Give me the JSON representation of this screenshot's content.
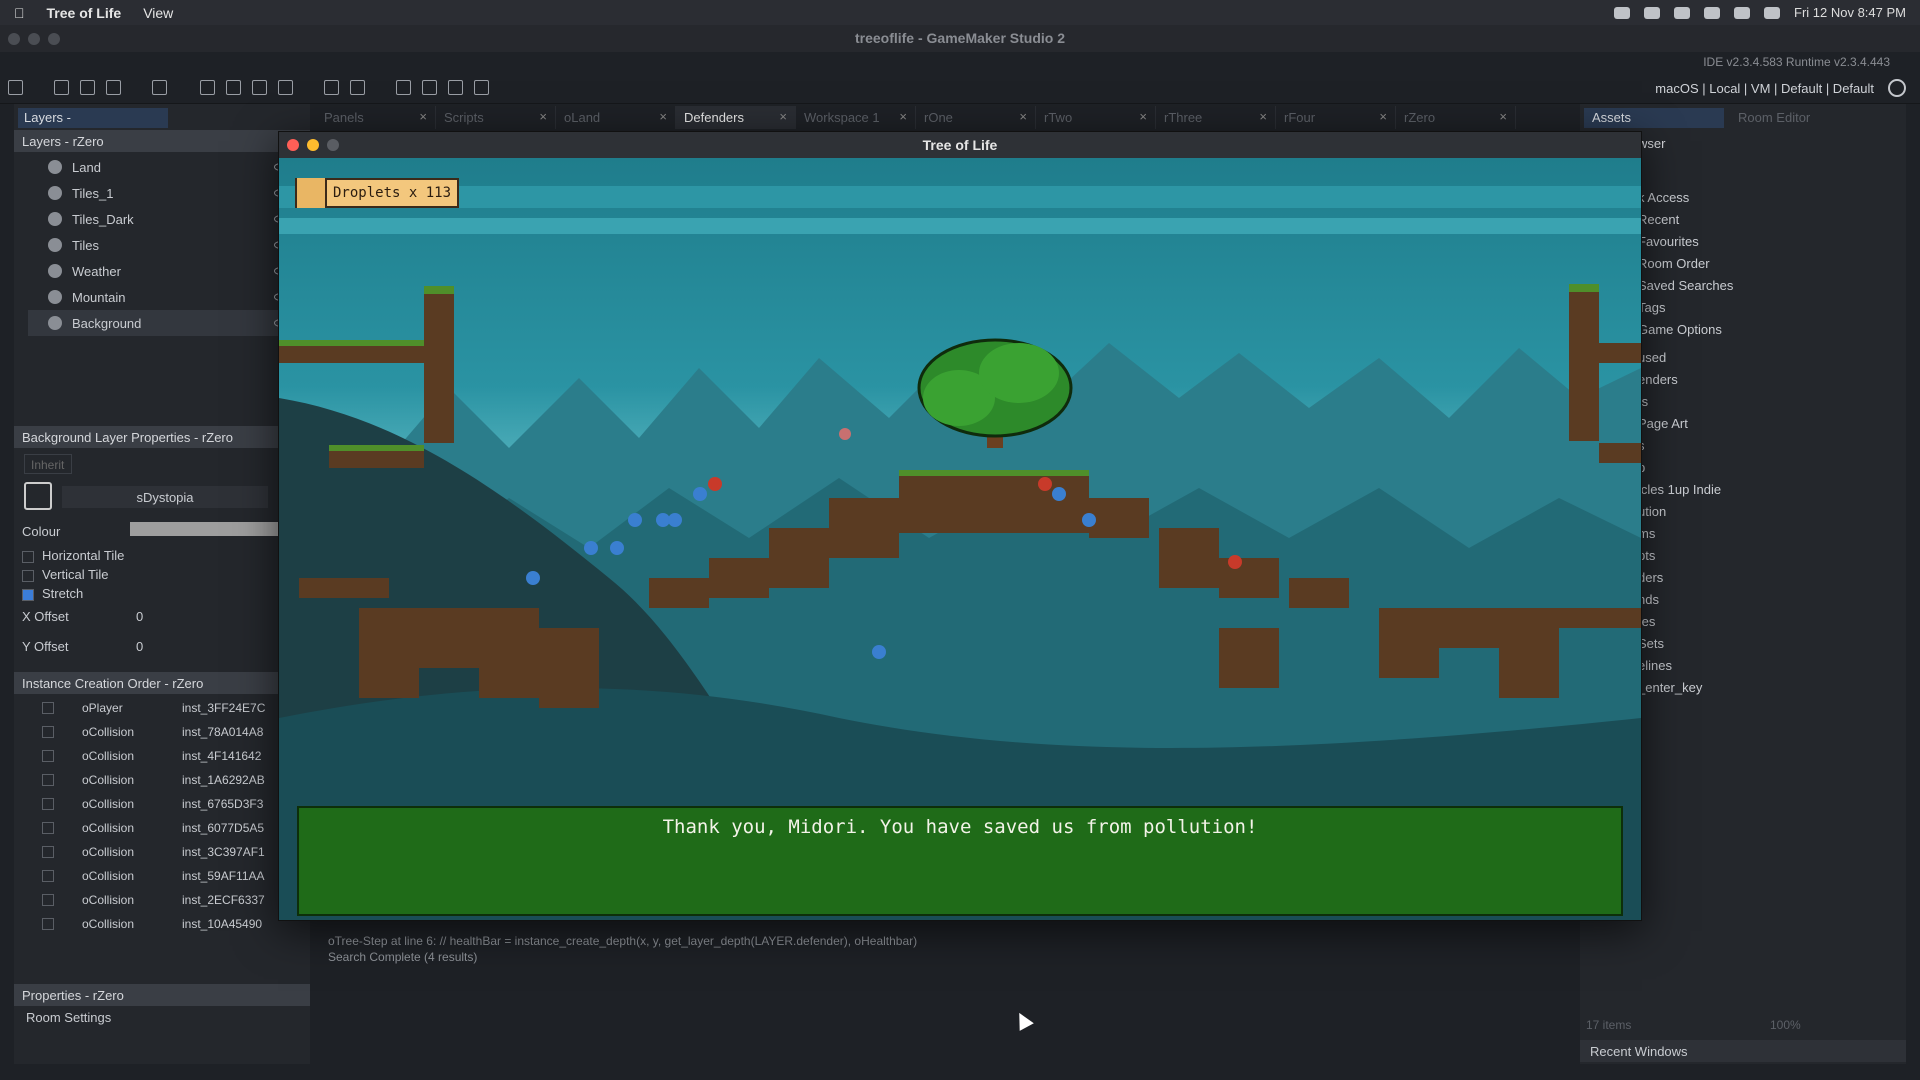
{
  "menubar": {
    "app_name": "Tree of Life",
    "view_menu": "View",
    "datetime": "Fri 12 Nov  8:47 PM"
  },
  "window": {
    "title": "treeoflife - GameMaker Studio 2",
    "ide_version": "IDE v2.3.4.583  Runtime v2.3.4.443"
  },
  "toolbar": {
    "targets": "macOS | Local | VM | Default | Default"
  },
  "tabs": [
    {
      "label": "Panels"
    },
    {
      "label": "Scripts"
    },
    {
      "label": "oLand"
    },
    {
      "label": "Defenders"
    },
    {
      "label": "Workspace 1"
    },
    {
      "label": "rOne"
    },
    {
      "label": "rTwo"
    },
    {
      "label": "rThree"
    },
    {
      "label": "rFour"
    },
    {
      "label": "rZero"
    }
  ],
  "left_panel": {
    "tab_label": "Layers -",
    "layers_title": "Layers - rZero",
    "layers": [
      {
        "label": "Land"
      },
      {
        "label": "Tiles_1"
      },
      {
        "label": "Tiles_Dark"
      },
      {
        "label": "Tiles"
      },
      {
        "label": "Weather"
      },
      {
        "label": "Mountain"
      },
      {
        "label": "Background"
      }
    ],
    "bg_props_title": "Background Layer Properties - rZero",
    "inherit": "Inherit",
    "sprite": "sDystopia",
    "colour": "Colour",
    "horizontal_tile": "Horizontal Tile",
    "vertical_tile": "Vertical Tile",
    "stretch": "Stretch",
    "x_offset_label": "X Offset",
    "x_offset": "0",
    "y_offset_label": "Y Offset",
    "y_offset": "0",
    "inst_title": "Instance Creation Order - rZero",
    "instances": [
      {
        "obj": "oPlayer",
        "id": "inst_3FF24E7C"
      },
      {
        "obj": "oCollision",
        "id": "inst_78A014A8"
      },
      {
        "obj": "oCollision",
        "id": "inst_4F141642"
      },
      {
        "obj": "oCollision",
        "id": "inst_1A6292AB"
      },
      {
        "obj": "oCollision",
        "id": "inst_6765D3F3"
      },
      {
        "obj": "oCollision",
        "id": "inst_6077D5A5"
      },
      {
        "obj": "oCollision",
        "id": "inst_3C397AF1"
      },
      {
        "obj": "oCollision",
        "id": "inst_59AF11AA"
      },
      {
        "obj": "oCollision",
        "id": "inst_2ECF6337"
      },
      {
        "obj": "oCollision",
        "id": "inst_10A45490"
      }
    ],
    "props_title": "Properties - rZero",
    "room_settings": "Room Settings"
  },
  "right_panel": {
    "tab_assets": "Assets",
    "tab_room_editor": "Room Editor",
    "browser": "wser",
    "items": [
      "k Access",
      "Recent",
      "Favourites",
      "Room Order",
      "Saved Searches",
      "Tags",
      "Game Options",
      "used",
      "enders",
      "ts",
      "Page Art",
      "s",
      "p",
      "icles 1up Indie",
      "ution",
      "ms",
      "pts",
      "ders",
      "nds",
      "tes",
      "Sets",
      "elines",
      "_enter_key"
    ],
    "count": "17 items",
    "zoom": "100%",
    "recent_windows": "Recent Windows"
  },
  "output": {
    "line1": "oTree-Step at line 6:  // healthBar = instance_create_depth(x, y, get_layer_depth(LAYER.defender), oHealthbar)",
    "line2": "Search Complete (4 results)"
  },
  "game": {
    "window_title": "Tree of Life",
    "hud_text": "Droplets x 113",
    "dialog": "Thank you, Midori. You have saved us from pollution!"
  }
}
